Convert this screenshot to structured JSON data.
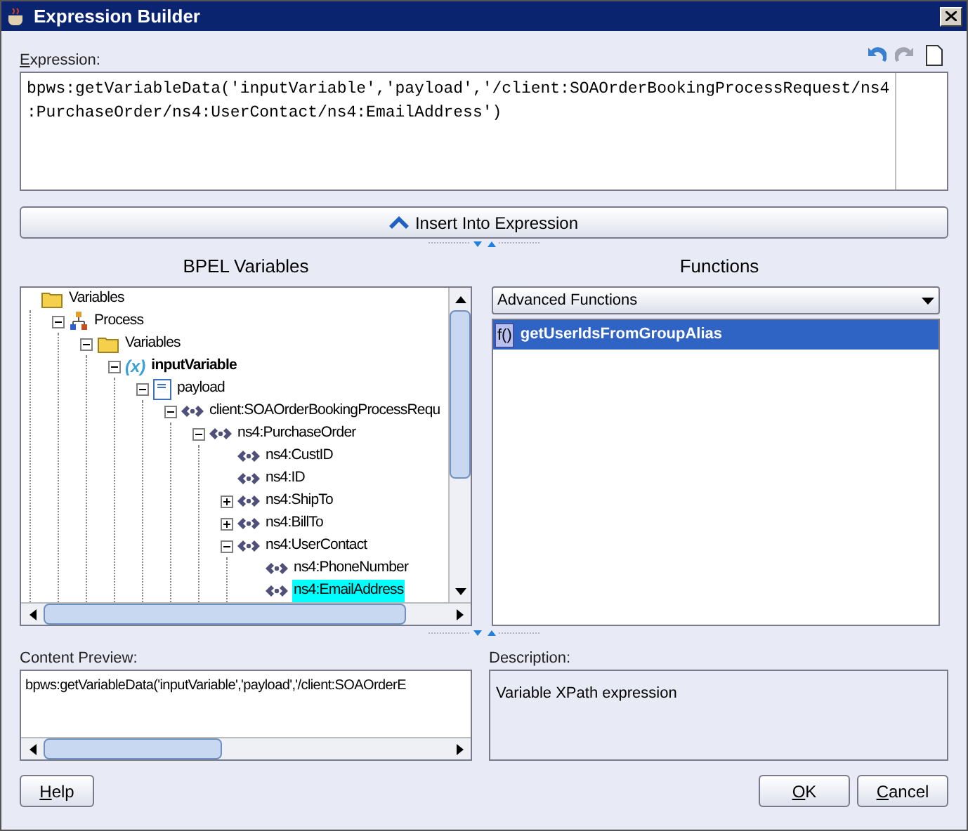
{
  "window": {
    "title": "Expression Builder"
  },
  "expression": {
    "label_key": "E",
    "label_rest": "xpression:",
    "value": "bpws:getVariableData('inputVariable','payload','/client:SOAOrderBookingProcessRequest/ns4\n:PurchaseOrder/ns4:UserContact/ns4:EmailAddress')"
  },
  "insert_button": "Insert Into Expression",
  "variables": {
    "title": "BPEL Variables",
    "tree": [
      {
        "label": "Variables",
        "kind": "folder",
        "selected": false,
        "bold": false,
        "children": [
          {
            "label": "Process",
            "kind": "process",
            "expanded": true,
            "selected": false,
            "bold": false,
            "children": [
              {
                "label": "Variables",
                "kind": "folder",
                "expanded": true,
                "selected": false,
                "bold": false,
                "children": [
                  {
                    "label": "inputVariable",
                    "kind": "variable",
                    "icon_text": "(x)",
                    "expanded": true,
                    "selected": false,
                    "bold": true,
                    "children": [
                      {
                        "label": "payload",
                        "kind": "document",
                        "expanded": true,
                        "selected": false,
                        "bold": false,
                        "children": [
                          {
                            "label": "client:SOAOrderBookingProcessRequ",
                            "kind": "element",
                            "expanded": true,
                            "selected": false,
                            "bold": false,
                            "children": [
                              {
                                "label": "ns4:PurchaseOrder",
                                "kind": "element",
                                "expanded": true,
                                "selected": false,
                                "bold": false,
                                "children": [
                                  {
                                    "label": "ns4:CustID",
                                    "kind": "element",
                                    "selected": false,
                                    "bold": false
                                  },
                                  {
                                    "label": "ns4:ID",
                                    "kind": "element",
                                    "selected": false,
                                    "bold": false
                                  },
                                  {
                                    "label": "ns4:ShipTo",
                                    "kind": "element",
                                    "expanded": false,
                                    "selected": false,
                                    "bold": false
                                  },
                                  {
                                    "label": "ns4:BillTo",
                                    "kind": "element",
                                    "expanded": false,
                                    "selected": false,
                                    "bold": false
                                  },
                                  {
                                    "label": "ns4:UserContact",
                                    "kind": "element",
                                    "expanded": true,
                                    "selected": false,
                                    "bold": false,
                                    "children": [
                                      {
                                        "label": "ns4:PhoneNumber",
                                        "kind": "element",
                                        "selected": false,
                                        "bold": false
                                      },
                                      {
                                        "label": "ns4:EmailAddress",
                                        "kind": "element",
                                        "selected": true,
                                        "bold": false
                                      }
                                    ]
                                  }
                                ]
                              }
                            ]
                          }
                        ]
                      }
                    ]
                  }
                ]
              }
            ]
          }
        ]
      }
    ]
  },
  "functions": {
    "title": "Functions",
    "category": "Advanced Functions",
    "items": [
      {
        "icon_text": "f()",
        "label": "getUserIdsFromGroupAlias",
        "selected": true
      }
    ]
  },
  "content_preview": {
    "label": "Content Preview:",
    "value": "bpws:getVariableData('inputVariable','payload','/client:SOAOrderE"
  },
  "description": {
    "label": "Description:",
    "value": "Variable XPath expression"
  },
  "buttons": [
    {
      "key": "H",
      "rest": "elp"
    },
    {
      "key": "O",
      "rest": "K"
    },
    {
      "key": "C",
      "rest": "ancel"
    }
  ]
}
